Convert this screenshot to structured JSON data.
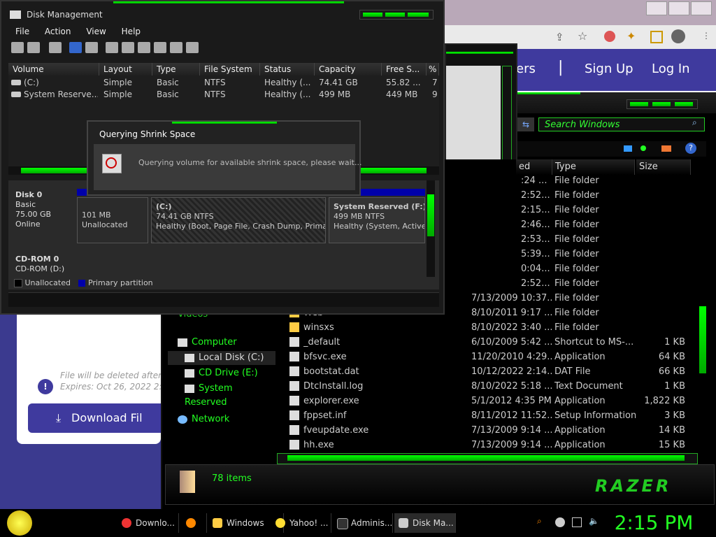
{
  "disk_mgmt": {
    "title": "Disk Management",
    "menu": [
      "File",
      "Action",
      "View",
      "Help"
    ],
    "columns": [
      "Volume",
      "Layout",
      "Type",
      "File System",
      "Status",
      "Capacity",
      "Free S...",
      "%"
    ],
    "volumes": [
      {
        "name": "(C:)",
        "layout": "Simple",
        "type": "Basic",
        "fs": "NTFS",
        "status": "Healthy (...",
        "capacity": "74.41 GB",
        "free": "55.82 ...",
        "pct": "7"
      },
      {
        "name": "System Reserve...",
        "layout": "Simple",
        "type": "Basic",
        "fs": "NTFS",
        "status": "Healthy (...",
        "capacity": "499 MB",
        "free": "449 MB",
        "pct": "9"
      }
    ],
    "disk0": {
      "name": "Disk 0",
      "type": "Basic",
      "size": "75.00 GB",
      "state": "Online"
    },
    "partitions": [
      {
        "size": "101 MB",
        "label": "Unallocated"
      },
      {
        "name": "(C:)",
        "size": "74.41 GB NTFS",
        "status": "Healthy (Boot, Page File, Crash Dump, Primary Pa"
      },
      {
        "name": "System Reserved  (F:)",
        "size": "499 MB NTFS",
        "status": "Healthy (System, Active, P"
      }
    ],
    "cdrom": {
      "name": "CD-ROM 0",
      "drive": "CD-ROM (D:)"
    },
    "legend": [
      "Unallocated",
      "Primary partition"
    ]
  },
  "dialog": {
    "title": "Querying Shrink Space",
    "message": "Querying volume for available shrink space, please wait..."
  },
  "browser": {
    "nav_partial": "ers",
    "sign_up": "Sign Up",
    "log_in": "Log In",
    "file_note": "File will be deleted after",
    "expires": "Expires: Oct 26, 2022 2:",
    "download": "Download Fil"
  },
  "explorer": {
    "search_placeholder": "Search Windows",
    "columns": [
      "ed",
      "Type",
      "Size"
    ],
    "folder_rows": [
      {
        "date": ":24 ...",
        "type": "File folder"
      },
      {
        "date": "2:52...",
        "type": "File folder"
      },
      {
        "date": "2:15...",
        "type": "File folder"
      },
      {
        "date": "2:46...",
        "type": "File folder"
      },
      {
        "date": "2:53...",
        "type": "File folder"
      },
      {
        "date": "5:39...",
        "type": "File folder"
      },
      {
        "date": "0:04...",
        "type": "File folder"
      },
      {
        "date": "2:52...",
        "type": "File folder"
      },
      {
        "date": "7/13/2009 10:37...",
        "type": "File folder"
      },
      {
        "name": "Web",
        "date": "8/10/2011 9:17 ...",
        "type": "File folder"
      },
      {
        "name": "winsxs",
        "date": "8/10/2022 3:40 ...",
        "type": "File folder"
      }
    ],
    "file_rows": [
      {
        "name": "_default",
        "date": "6/10/2009 5:42 ...",
        "type": "Shortcut to MS-...",
        "size": "1 KB"
      },
      {
        "name": "bfsvc.exe",
        "date": "11/20/2010 4:29...",
        "type": "Application",
        "size": "64 KB"
      },
      {
        "name": "bootstat.dat",
        "date": "10/12/2022 2:14...",
        "type": "DAT File",
        "size": "66 KB"
      },
      {
        "name": "DtcInstall.log",
        "date": "8/10/2022 5:18 ...",
        "type": "Text Document",
        "size": "1 KB"
      },
      {
        "name": "explorer.exe",
        "date": "5/1/2012 4:35 PM",
        "type": "Application",
        "size": "1,822 KB"
      },
      {
        "name": "fppset.inf",
        "date": "8/11/2012 11:52...",
        "type": "Setup Information",
        "size": "3 KB"
      },
      {
        "name": "fveupdate.exe",
        "date": "7/13/2009 9:14 ...",
        "type": "Application",
        "size": "14 KB"
      },
      {
        "name": "hh.exe",
        "date": "7/13/2009 9:14 ...",
        "type": "Application",
        "size": "15 KB"
      }
    ],
    "sidebar": {
      "videos": "Videos",
      "computer": "Computer",
      "local_disk": "Local Disk (C:)",
      "cd_drive": "CD Drive (E:)",
      "system_reserved": "System Reserved",
      "network": "Network"
    },
    "status_count": "78 items",
    "brand": "RAZER"
  },
  "taskbar": {
    "items": [
      "Downlo...",
      "",
      "Windows",
      "Yahoo! ...",
      "Adminis...",
      "Disk Ma..."
    ],
    "clock": "2:15 PM"
  },
  "colors": {
    "accent_green": "#22ff22",
    "dark_bg": "#1a1a1a",
    "browser_purple": "#3f3a9e"
  }
}
